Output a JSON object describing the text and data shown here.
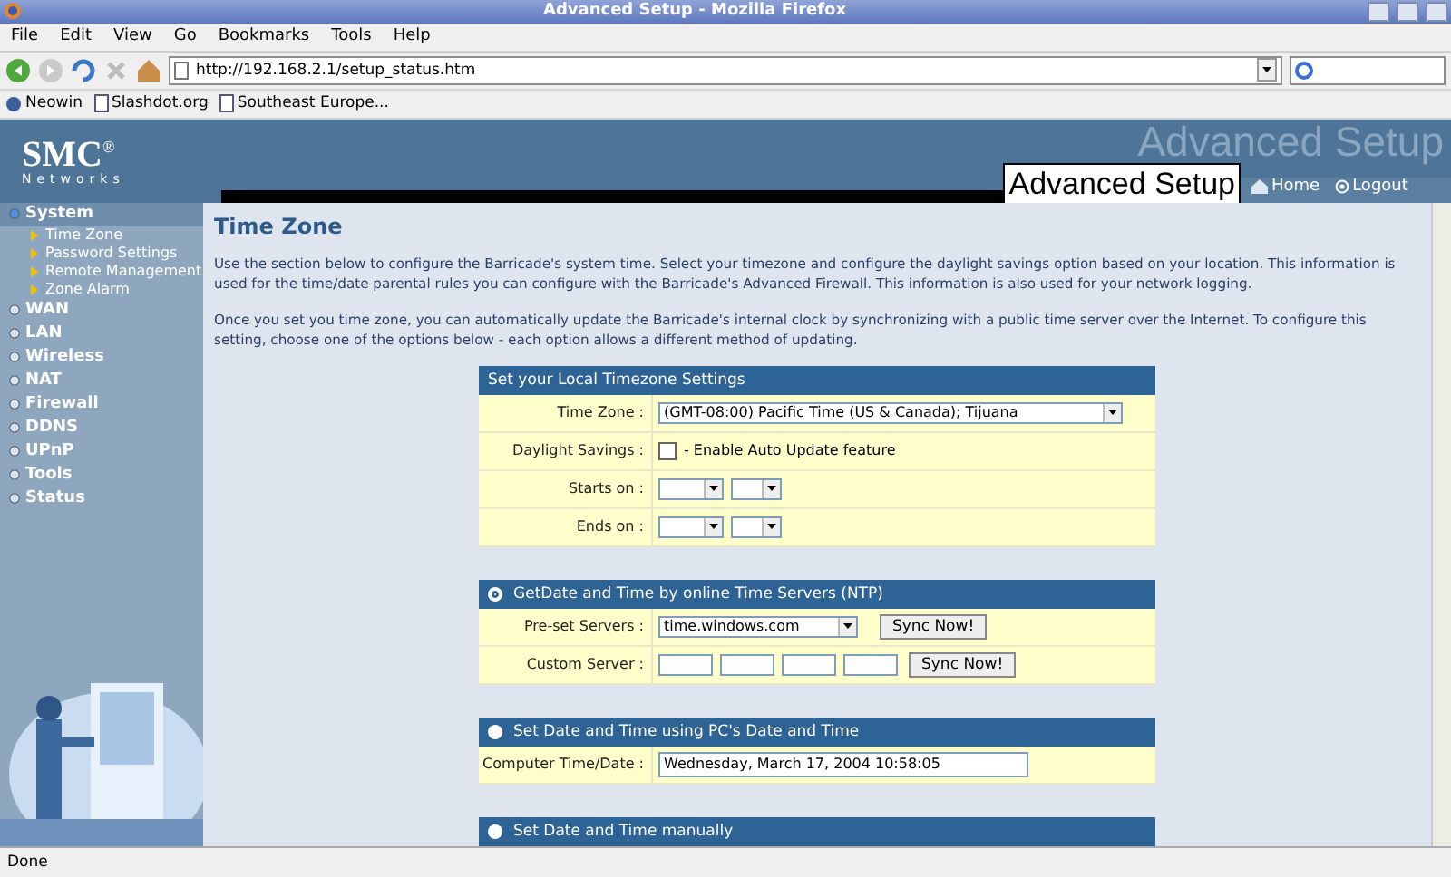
{
  "window": {
    "title": "Advanced Setup - Mozilla Firefox"
  },
  "menu": [
    "File",
    "Edit",
    "View",
    "Go",
    "Bookmarks",
    "Tools",
    "Help"
  ],
  "address": {
    "value": "http://192.168.2.1/setup_status.htm"
  },
  "bookmarks": [
    {
      "label": "Neowin",
      "kind": "site"
    },
    {
      "label": "Slashdot.org",
      "kind": "page"
    },
    {
      "label": "Southeast Europe...",
      "kind": "page"
    }
  ],
  "header": {
    "logo": "SMC",
    "logo_mark": "®",
    "logo_sub": "Networks",
    "banner": "Advanced Setup",
    "title": "Advanced Setup",
    "links": [
      {
        "label": "Home",
        "kind": "home"
      },
      {
        "label": "Logout",
        "kind": "logout"
      }
    ]
  },
  "sidebar": {
    "items": [
      {
        "label": "System",
        "selected": true,
        "children": [
          {
            "label": "Time Zone"
          },
          {
            "label": "Password Settings"
          },
          {
            "label": "Remote Management"
          },
          {
            "label": "Zone Alarm"
          }
        ]
      },
      {
        "label": "WAN",
        "selected": false
      },
      {
        "label": "LAN",
        "selected": false
      },
      {
        "label": "Wireless",
        "selected": false
      },
      {
        "label": "NAT",
        "selected": false
      },
      {
        "label": "Firewall",
        "selected": false
      },
      {
        "label": "DDNS",
        "selected": false
      },
      {
        "label": "UPnP",
        "selected": false
      },
      {
        "label": "Tools",
        "selected": false
      },
      {
        "label": "Status",
        "selected": false
      }
    ]
  },
  "content": {
    "title": "Time Zone",
    "paragraphs": [
      "Use the section below to configure the Barricade's system time. Select your timezone and configure the daylight savings option based on your location. This information is used for the time/date parental rules you can configure with the Barricade's Advanced Firewall. This information is also used for your network logging.",
      "Once you set you time zone, you can automatically update the Barricade's internal clock by synchronizing with a public time server over the Internet. To configure this setting, choose one of the options below - each option allows a different method of updating."
    ],
    "sections": [
      {
        "title": "Set your Local Timezone Settings",
        "rows": [
          {
            "label": "Time Zone :",
            "kind": "select",
            "value": "(GMT-08:00) Pacific Time (US & Canada); Tijuana"
          },
          {
            "label": "Daylight Savings :",
            "kind": "checkbox",
            "checked": false,
            "text": "- Enable Auto Update feature"
          },
          {
            "label": "Starts on :",
            "kind": "pair"
          },
          {
            "label": "Ends on :",
            "kind": "pair"
          }
        ]
      },
      {
        "title": "GetDate and Time by online Time Servers (NTP)",
        "selected": true,
        "rows": [
          {
            "label": "Pre-set Servers :",
            "kind": "select_button",
            "value": "time.windows.com",
            "button": "Sync Now!"
          },
          {
            "label": "Custom Server :",
            "kind": "ip_button",
            "button": "Sync Now!"
          }
        ]
      },
      {
        "title": "Set Date and Time using PC's Date and Time",
        "selected": false,
        "rows": [
          {
            "label": "Computer Time/Date :",
            "kind": "text",
            "value": "Wednesday, March 17, 2004 10:58:05"
          }
        ]
      },
      {
        "title": "Set Date and Time manually",
        "selected": false
      }
    ]
  },
  "status_bar": "Done"
}
